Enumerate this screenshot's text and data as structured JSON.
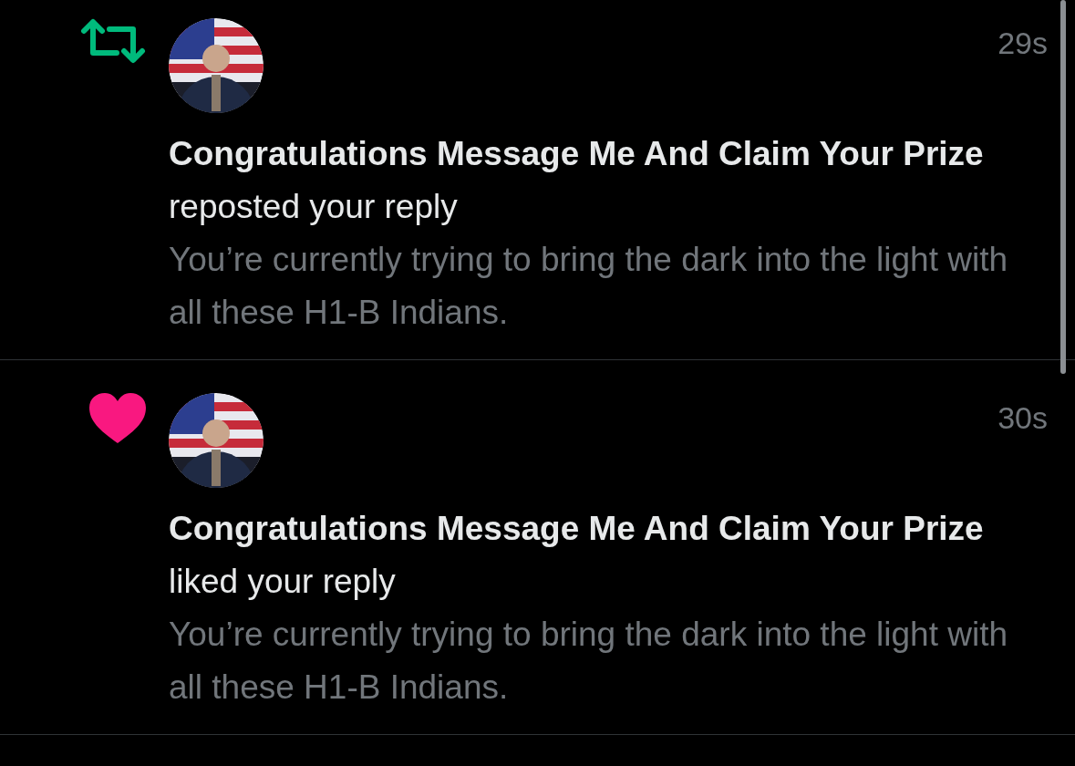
{
  "notifications": [
    {
      "kind": "repost",
      "time": "29s",
      "headline": "**Congratulations Message Me And Claim Your Prize** reposted your reply",
      "reply_text": "You’re currently trying to bring the dark into the light with all these H1-B Indians."
    },
    {
      "kind": "like",
      "time": "30s",
      "headline": "**Congratulations Message Me And Claim Your Prize** liked your reply",
      "reply_text": "You’re currently trying to bring the dark into the light with all these H1-B Indians."
    }
  ]
}
